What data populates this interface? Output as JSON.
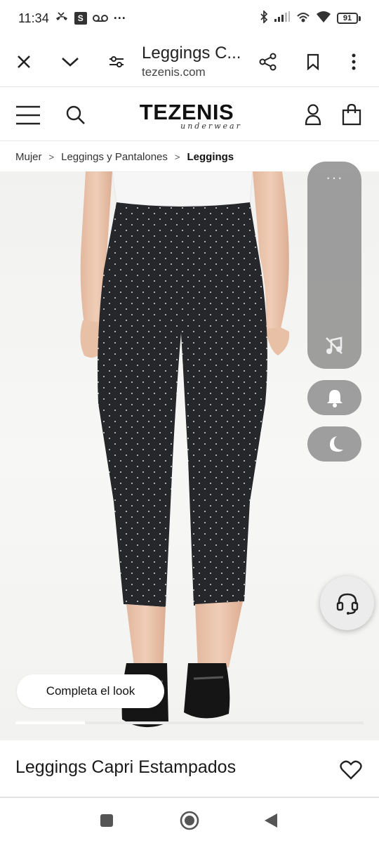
{
  "status_bar": {
    "time": "11:34",
    "battery": "91",
    "icons": [
      "missed-call-icon",
      "s-app-icon",
      "voicemail-icon",
      "more-dots-icon",
      "bluetooth-icon",
      "signal-icon",
      "hotspot-icon",
      "wifi-icon",
      "battery-icon"
    ],
    "s_badge": "S",
    "more": "···"
  },
  "browser": {
    "page_title": "Leggings C...",
    "domain": "tezenis.com"
  },
  "header": {
    "logo": "TEZENIS",
    "logo_sub": "underwear"
  },
  "breadcrumb": {
    "items": [
      "Mujer",
      "Leggings y Pantalones"
    ],
    "current": "Leggings",
    "separator": ">"
  },
  "gallery": {
    "complete_look_label": "Completa el look",
    "progress_fraction": 0.2
  },
  "product": {
    "title": "Leggings Capri Estampados"
  },
  "colors": {
    "leggings": "#26272b",
    "overlay": "#969696"
  }
}
